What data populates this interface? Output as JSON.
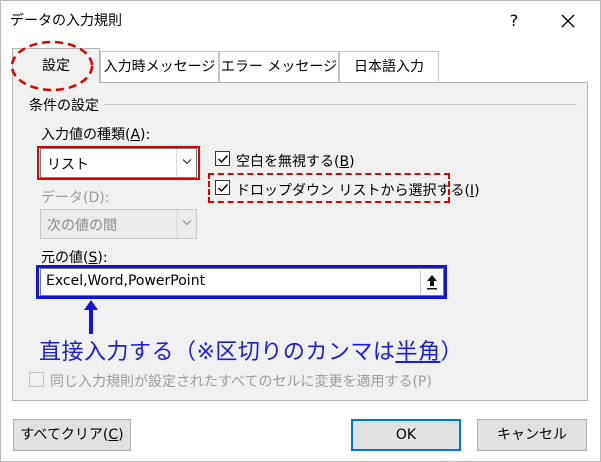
{
  "window": {
    "title": "データの入力規則",
    "help_label": "?",
    "close_label": "✕"
  },
  "tabs": [
    {
      "label": "設定",
      "active": true
    },
    {
      "label": "入力時メッセージ",
      "active": false
    },
    {
      "label": "エラー メッセージ",
      "active": false
    },
    {
      "label": "日本語入力",
      "active": false
    }
  ],
  "conditions": {
    "section_title": "条件の設定",
    "allow_label_pre": "入力値の種類(",
    "allow_label_key": "A",
    "allow_label_post": "):",
    "allow_value": "リスト",
    "data_label": "データ(D):",
    "data_value": "次の値の間",
    "ignore_blank_pre": "空白を無視する(",
    "ignore_blank_key": "B",
    "ignore_blank_post": ")",
    "ignore_blank_checked": true,
    "dropdown_pre": "ドロップダウン リストから選択する(",
    "dropdown_key": "I",
    "dropdown_post": ")",
    "dropdown_checked": true,
    "source_label_pre": "元の値(",
    "source_label_key": "S",
    "source_label_post": "):",
    "source_value": "Excel,Word,PowerPoint",
    "apply_all_label": "同じ入力規則が設定されたすべてのセルに変更を適用する(P)",
    "apply_all_checked": false
  },
  "annotation": {
    "text_pre": "直接入力する（※区切りのカンマは",
    "text_underlined": "半角",
    "text_post": "）",
    "color_red": "#e00000",
    "color_blue": "#1c1ce0"
  },
  "buttons": {
    "clear_all_pre": "すべてクリア(",
    "clear_all_key": "C",
    "clear_all_post": ")",
    "ok": "OK",
    "cancel": "キャンセル"
  }
}
